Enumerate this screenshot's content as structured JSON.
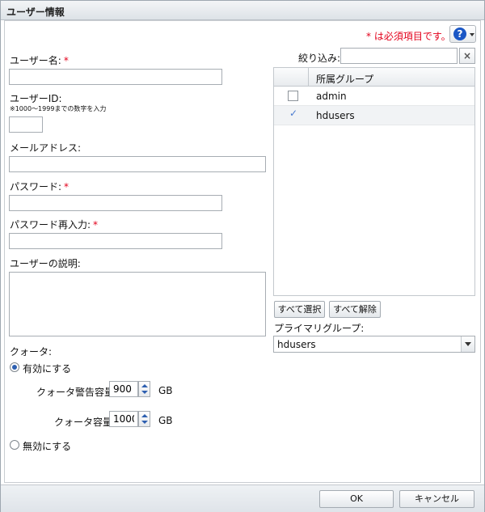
{
  "dialog": {
    "title": "ユーザー情報"
  },
  "required_note": "* は必須項目です。",
  "help": {
    "symbol": "?"
  },
  "form": {
    "username": {
      "label": "ユーザー名:",
      "required": "*",
      "value": ""
    },
    "userid": {
      "label": "ユーザーID:",
      "hint": "※1000～1999までの数字を入力",
      "value": ""
    },
    "email": {
      "label": "メールアドレス:",
      "value": ""
    },
    "password": {
      "label": "パスワード:",
      "required": "*",
      "value": ""
    },
    "password_confirm": {
      "label": "パスワード再入力:",
      "required": "*",
      "value": ""
    },
    "description": {
      "label": "ユーザーの説明:",
      "value": ""
    }
  },
  "quota": {
    "label": "クォータ:",
    "enable_label": "有効にする",
    "warning_label": "クォータ警告容量:",
    "warning_value": "900",
    "warning_unit": "GB",
    "capacity_label": "クォータ容量:",
    "capacity_value": "1000",
    "capacity_unit": "GB",
    "disable_label": "無効にする"
  },
  "groups": {
    "filter_label": "絞り込み:",
    "filter_value": "",
    "clear_symbol": "×",
    "column_header": "所属グループ",
    "rows": [
      {
        "name": "admin",
        "checked": false
      },
      {
        "name": "hdusers",
        "checked": true
      }
    ],
    "select_all": "すべて選択",
    "deselect_all": "すべて解除",
    "primary_label": "プライマリグループ:",
    "primary_value": "hdusers"
  },
  "footer": {
    "ok": "OK",
    "cancel": "キャンセル"
  }
}
